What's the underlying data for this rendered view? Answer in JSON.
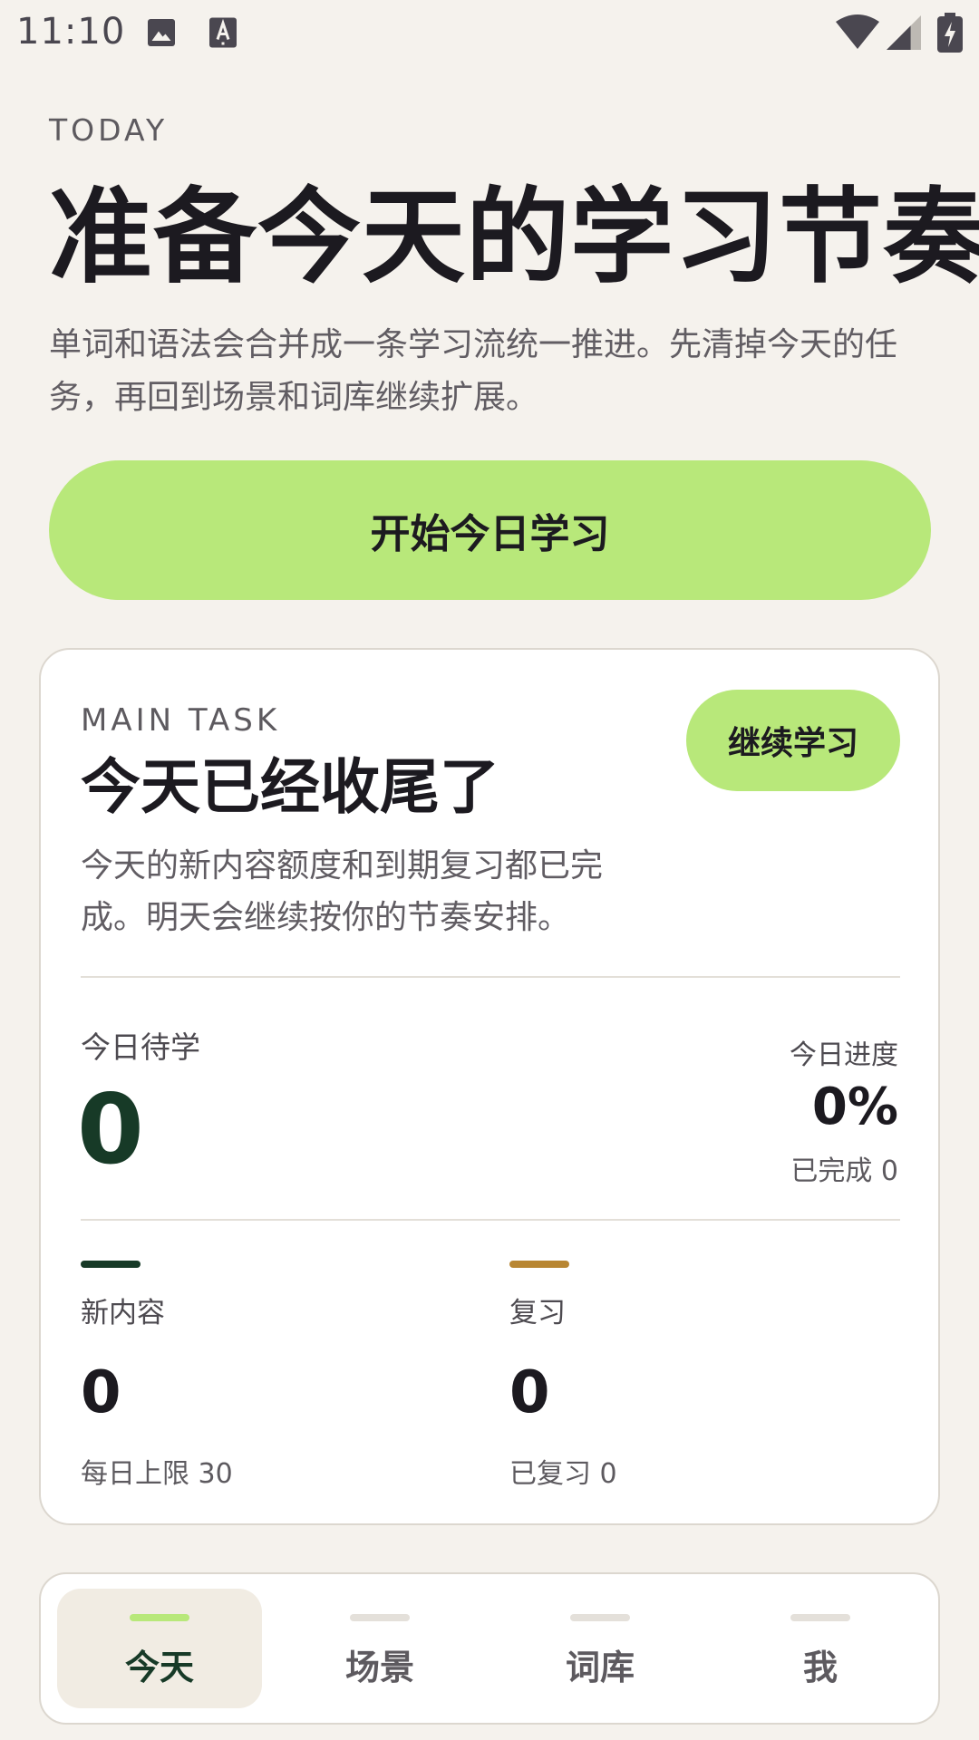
{
  "status_bar": {
    "time": "11:10",
    "icons": [
      "image-notification-icon",
      "text-a-notification-icon",
      "wifi-icon",
      "cellular-signal-icon",
      "battery-charging-icon"
    ]
  },
  "header": {
    "eyebrow": "TODAY",
    "title": "准备今天的学习节奏",
    "subtitle": "单词和语法会合并成一条学习流统一推进。先清掉今天的任务，再回到场景和词库继续扩展。",
    "primary_button": "开始今日学习"
  },
  "main_task": {
    "eyebrow": "MAIN TASK",
    "title": "今天已经收尾了",
    "description": "今天的新内容额度和到期复习都已完成。明天会继续按你的节奏安排。",
    "continue_button": "继续学习",
    "pending_label": "今日待学",
    "pending_value": "0",
    "progress_label": "今日进度",
    "progress_value": "0%",
    "progress_done": "已完成 0",
    "new_content": {
      "label": "新内容",
      "value": "0",
      "note": "每日上限 30",
      "accent": "#173a27"
    },
    "review": {
      "label": "复习",
      "value": "0",
      "note": "已复习 0",
      "accent": "#b88632"
    }
  },
  "nav": {
    "items": [
      {
        "label": "今天",
        "active": true
      },
      {
        "label": "场景",
        "active": false
      },
      {
        "label": "词库",
        "active": false
      },
      {
        "label": "我",
        "active": false
      }
    ]
  },
  "colors": {
    "background": "#f5f2ed",
    "accent_green": "#b8e87a",
    "dark_green": "#173a27"
  }
}
